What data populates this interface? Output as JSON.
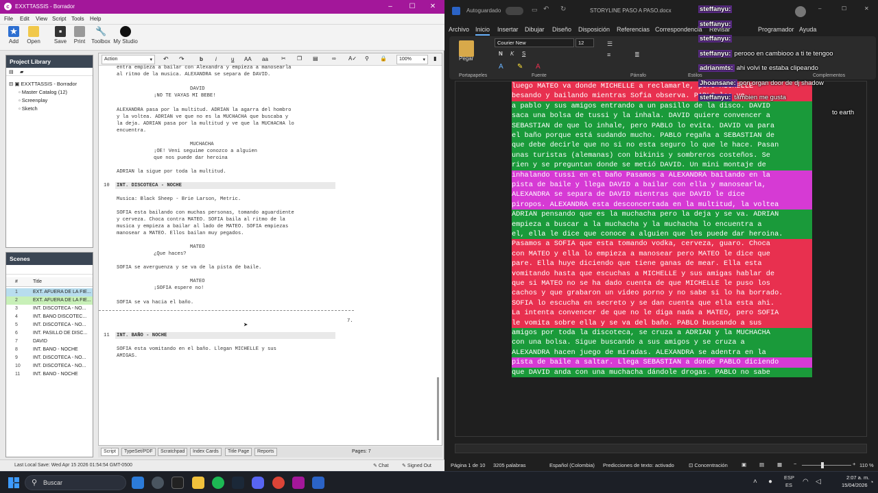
{
  "left_app": {
    "title": "EXXTTASSIS - Borrador",
    "menu": [
      "File",
      "Edit",
      "View",
      "Script",
      "Tools",
      "Help"
    ],
    "toolbar": [
      "Add",
      "Open",
      "Save",
      "Print",
      "Toolbox",
      "My Studio"
    ],
    "project_library": {
      "header": "Project Library",
      "items": [
        "EXXTTASSIS - Borrador",
        "Master Catalog (12)",
        "Screenplay",
        "Sketch"
      ]
    },
    "scenes": {
      "header": "Scenes",
      "col_num": "#",
      "col_title": "Title",
      "rows": [
        {
          "n": "1",
          "title": "EXT. AFUERA DE LA FIE..."
        },
        {
          "n": "2",
          "title": "EXT. AFUERA DE LA FIE..."
        },
        {
          "n": "3",
          "title": "INT. DISCOTECA - NO..."
        },
        {
          "n": "4",
          "title": "INT. BAÑO DISCOTEC..."
        },
        {
          "n": "5",
          "title": "INT. DISCOTECA - NO..."
        },
        {
          "n": "6",
          "title": "INT. PASILLO DE DISC..."
        },
        {
          "n": "7",
          "title": "DAVID"
        },
        {
          "n": "8",
          "title": "INT. BAÑO - NOCHE"
        },
        {
          "n": "9",
          "title": "INT. DISCOTECA - NO..."
        },
        {
          "n": "10",
          "title": "INT. DISCOTECA - NO..."
        },
        {
          "n": "11",
          "title": "INT. BAÑO - NOCHE"
        }
      ]
    },
    "editor": {
      "element_select": "Action",
      "zoom": "100%",
      "lines": [
        "entra empieza a bailar con Alexandra y empieza a manosearla",
        "al ritmo de la musica. ALEXANDRA se separa de DAVID.",
        "DAVID",
        "¡NO TE VAYAS MI BEBE!",
        "ALEXANDRA pasa por la multitud. ADRIAN la agarra del hombro",
        "y la voltea. ADRIAN ve que no es la MUCHACHA que buscaba y",
        "la deja. ADRIAN pasa por la multitud y ve que la MUCHACHA lo",
        "encuentra.",
        "MUCHACHA",
        "¡OE! Veni seguime conozco a alguien",
        "que nos puede dar heroina",
        "ADRIAN la sigue por toda la multitud.",
        "10",
        "INT. DISCOTECA - NOCHE",
        "Musica: Black Sheep - Brie Larson, Metric.",
        "SOFIA esta bailando con muchas personas, tomando aguardiente",
        "y cerveza. Choca contra MATEO. SOFIA baila al ritmo de la",
        "musica y empieza a bailar al lado de MATEO. SOFIA empiezas",
        "manosear a MATEO. Ellos bailan muy pegados.",
        "MATEO",
        "¿Que haces?",
        "SOFIA se averguenza y se va de la pista de baile.",
        "MATEO",
        "¡SOFIA espere no!",
        "SOFIA se va hacia el baño.",
        "7.",
        "11",
        "INT. BAÑO - NOCHE",
        "SOFIA esta vomitando en el baño. Llegan MICHELLE y sus",
        "AMIGAS."
      ]
    },
    "bottom_tabs": [
      "Script",
      "TypeSet/PDF",
      "Scratchpad",
      "Index Cards",
      "Title Page",
      "Reports"
    ],
    "pages": "Pages: 7",
    "last_save": "Last Local Save: Wed Apr 15 2026 01:54:54 GMT-0500",
    "chat": "Chat",
    "signed_out": "Signed Out"
  },
  "word": {
    "autosave": "Autoguardado",
    "doc_title": "STORYLINE PASO A PASO.docx",
    "menu": [
      "Archivo",
      "Inicio",
      "Insertar",
      "Dibujar",
      "Diseño",
      "Disposición",
      "Referencias",
      "Correspondencia",
      "Revisar",
      "Programador",
      "Ayuda"
    ],
    "font_name": "Courier New",
    "font_size": "12",
    "ribbon_groups": [
      "Portapapeles",
      "Fuente",
      "Párrafo",
      "Estilos",
      "Complementos"
    ],
    "paste_label": "Pegar",
    "lines": [
      {
        "t": "luego MATEO va donde MICHELLE a reclamarle, pero MICHELLE",
        "c": "#e8304f"
      },
      {
        "t": "besando y bailando mientras Sofia observa. PABLO los ve",
        "c": "#e8304f"
      },
      {
        "t": "a pablo y sus amigos entrando a un pasillo de la disco. DAVID",
        "c": "#1a9a3a"
      },
      {
        "t": "saca una bolsa de tussi y la inhala. DAVID quiere convencer a",
        "c": "#1a9a3a"
      },
      {
        "t": "SEBASTIAN de que lo inhale, pero PABLO lo evita. DAVID va para",
        "c": "#1a9a3a"
      },
      {
        "t": "el baño porque está sudando mucho. PABLO regaña a SEBASTIAN de",
        "c": "#1a9a3a"
      },
      {
        "t": "que debe decirle que no si no esta seguro lo que le hace. Pasan",
        "c": "#1a9a3a"
      },
      {
        "t": "unas turistas (alemanas) con bikinis y sombreros costeños. Se",
        "c": "#1a9a3a"
      },
      {
        "t": "rien y se preguntan donde se metió DAVID. Un mini montaje de",
        "c": "#1a9a3a"
      },
      {
        "t": "inhalando tussi en el baño Pasamos a ALEXANDRA bailando en la",
        "c": "#d63ad4"
      },
      {
        "t": "pista de baile y llega DAVID a bailar con ella y manosearla,",
        "c": "#d63ad4"
      },
      {
        "t": "ALEXANDRA se separa de DAVID mientras que DAVID le dice",
        "c": "#d63ad4"
      },
      {
        "t": "piropos. ALEXANDRA esta desconcertada en la multitud, la voltea",
        "c": "#d63ad4"
      },
      {
        "t": "ADRIAN pensando que es la muchacha pero la deja y se va. ADRIAN",
        "c": "#1a9a3a"
      },
      {
        "t": "empieza a buscar a la muchacha y la muchacha lo encuentra a",
        "c": "#1a9a3a"
      },
      {
        "t": "el, ella le dice que conoce a alguien que les puede dar heroina.",
        "c": "#1a9a3a"
      },
      {
        "t": "Pasamos a SOFIA que esta tomando vodka, cerveza, guaro. Choca",
        "c": "#e8304f"
      },
      {
        "t": "con MATEO y ella lo empieza a manosear pero MATEO le dice que",
        "c": "#e8304f"
      },
      {
        "t": "pare. Ella huye diciendo que tiene ganas de mear. Ella esta",
        "c": "#e8304f"
      },
      {
        "t": "vomitando hasta que escuchas a MICHELLE y sus amigas hablar de",
        "c": "#e8304f"
      },
      {
        "t": "que si MATEO no se ha dado cuenta de que MICHELLE le puso los",
        "c": "#e8304f"
      },
      {
        "t": "cachos y que grabaron un video porno y no sabe si lo ha borrado.",
        "c": "#e8304f"
      },
      {
        "t": "SOFIA lo escucha en secreto y se dan cuenta que ella esta ahi.",
        "c": "#e8304f"
      },
      {
        "t": "La intenta convencer de que no le diga nada a MATEO, pero SOFIA",
        "c": "#e8304f"
      },
      {
        "t": "le vomita sobre ella y se va del baño. PABLO buscando a sus",
        "c": "#e8304f"
      },
      {
        "t": "amigos por toda la discoteca, se cruza a ADRIAN y la MUCHACHA",
        "c": "#1a9a3a"
      },
      {
        "t": "con una bolsa. Sigue buscando a sus amigos y se cruza a",
        "c": "#1a9a3a"
      },
      {
        "t": "ALEXANDRA hacen juego de miradas. ALEXANDRA se adentra en la",
        "c": "#1a9a3a"
      },
      {
        "t": "pista de baile a saltar. Llega SEBASTIAN a donde PABLO diciendo",
        "c": "#d63ad4"
      },
      {
        "t": "que DAVID anda con una muchacha dándole drogas. PABLO no sabe",
        "c": "#1a9a3a"
      }
    ],
    "status": {
      "page": "Página 1 de 10",
      "words": "3205 palabras",
      "language": "Español (Colombia)",
      "predictions": "Predicciones de texto: activado",
      "focus": "Concentración",
      "zoom": "110 %"
    }
  },
  "chat_overlay": [
    {
      "user": "steffanyu:",
      "msg": ""
    },
    {
      "user": "steffanyu:",
      "msg": ""
    },
    {
      "user": "steffanyu:",
      "msg": ""
    },
    {
      "user": "steffanyu:",
      "msg": "perooo en cambiooo a ti te tengoo"
    },
    {
      "user": "adrianmts:",
      "msg": "ahi volvi te estaba clipeando"
    },
    {
      "user": "Jhoansane:",
      "msg": "pon organ door de dj shadow"
    },
    {
      "user": "steffanyu:",
      "msg": "tambien me gusta"
    },
    {
      "user": "",
      "msg": "to earth"
    }
  ],
  "taskbar": {
    "search": "Buscar",
    "lang": "ESP",
    "region": "ES",
    "time": "2:07 a. m.",
    "date": "15/04/2026"
  }
}
